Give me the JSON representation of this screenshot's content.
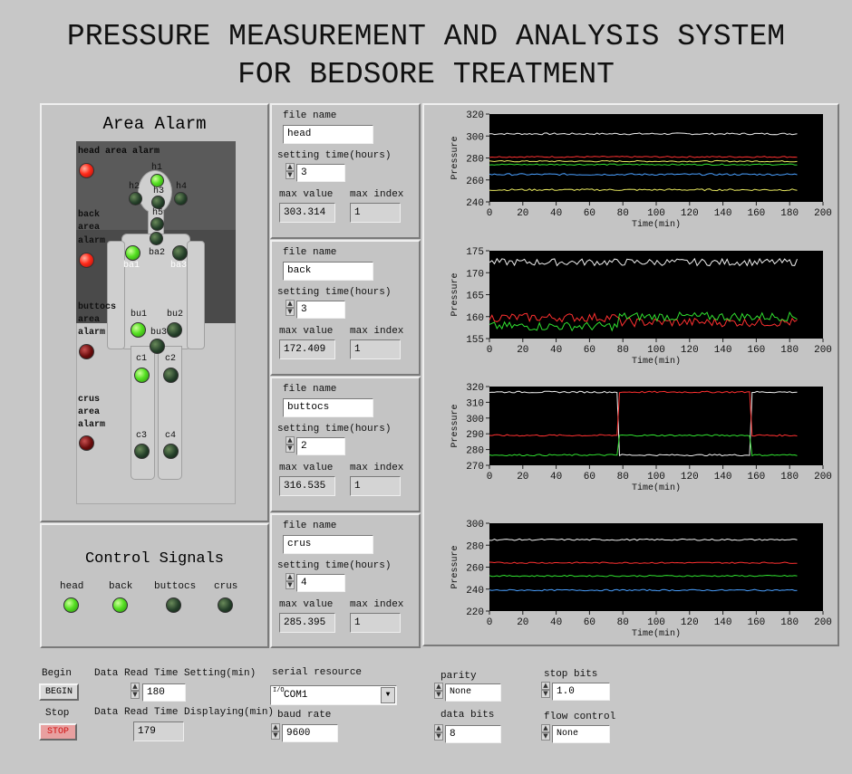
{
  "title_line1": "PRESSURE MEASUREMENT AND ANALYSIS SYSTEM",
  "title_line2": "FOR BEDSORE TREATMENT",
  "area_alarm": {
    "title": "Area Alarm",
    "alarm_labels": {
      "head": "head area alarm",
      "back1": "back",
      "back2": "area",
      "back3": "alarm",
      "buttocs1": "buttocs",
      "buttocs2": "area",
      "buttocs3": "alarm",
      "crus1": "crus",
      "crus2": "area",
      "crus3": "alarm"
    },
    "sensors": {
      "h1": "h1",
      "h2": "h2",
      "h3": "h3",
      "h4": "h4",
      "h5": "h5",
      "ba1": "ba1",
      "ba2": "ba2",
      "ba3": "ba3",
      "bu1": "bu1",
      "bu2": "bu2",
      "bu3": "bu3",
      "c1": "c1",
      "c2": "c2",
      "c3": "c3",
      "c4": "c4"
    }
  },
  "control_signals": {
    "title": "Control Signals",
    "labels": [
      "head",
      "back",
      "buttocs",
      "crus"
    ]
  },
  "areas": [
    {
      "file_name_label": "file name",
      "file_name": "head",
      "setting_label": "setting time(hours)",
      "setting_time": "3",
      "max_value_label": "max value",
      "max_value": "303.314",
      "max_index_label": "max index",
      "max_index": "1"
    },
    {
      "file_name_label": "file name",
      "file_name": "back",
      "setting_label": "setting time(hours)",
      "setting_time": "3",
      "max_value_label": "max value",
      "max_value": "172.409",
      "max_index_label": "max index",
      "max_index": "1"
    },
    {
      "file_name_label": "file name",
      "file_name": "buttocs",
      "setting_label": "setting time(hours)",
      "setting_time": "2",
      "max_value_label": "max value",
      "max_value": "316.535",
      "max_index_label": "max index",
      "max_index": "1"
    },
    {
      "file_name_label": "file name",
      "file_name": "crus",
      "setting_label": "setting time(hours)",
      "setting_time": "4",
      "max_value_label": "max value",
      "max_value": "285.395",
      "max_index_label": "max index",
      "max_index": "1"
    }
  ],
  "bottom": {
    "begin_label": "Begin",
    "begin_button": "BEGIN",
    "stop_label": "Stop",
    "stop_button": "STOP",
    "read_setting_label": "Data Read Time Setting(min)",
    "read_setting_value": "180",
    "read_display_label": "Data Read Time Displaying(min)",
    "read_display_value": "179",
    "serial_label": "serial resource",
    "serial_value": "COM1",
    "serial_prefix": "I/O",
    "baud_label": "baud rate",
    "baud_value": "9600",
    "parity_label": "parity",
    "parity_value": "None",
    "data_bits_label": "data bits",
    "data_bits_value": "8",
    "stop_bits_label": "stop bits",
    "stop_bits_value": "1.0",
    "flow_label": "flow control",
    "flow_value": "None"
  },
  "colors": {
    "panel": "#c4c4c4",
    "plot_bg": "#000000",
    "white": "#f0f0f0",
    "red": "#ff3030",
    "green": "#30e030",
    "blue": "#4aa0ff",
    "yellow": "#e8e860"
  },
  "chart_data": [
    {
      "type": "line",
      "ylabel": "Pressure",
      "xlabel": "Time(min)",
      "xlim": [
        0,
        200
      ],
      "ylim": [
        240,
        320
      ],
      "xticks": [
        0,
        20,
        40,
        60,
        80,
        100,
        120,
        140,
        160,
        180,
        200
      ],
      "yticks": [
        240,
        260,
        280,
        300,
        320
      ],
      "x_end": 185,
      "series": [
        {
          "color": "white",
          "mean": 302,
          "amp": 0.8
        },
        {
          "color": "red",
          "mean": 281,
          "amp": 0.6
        },
        {
          "color": "yellow",
          "mean": 277,
          "amp": 0.6
        },
        {
          "color": "green",
          "mean": 274,
          "amp": 0.6
        },
        {
          "color": "blue",
          "mean": 265,
          "amp": 0.8
        },
        {
          "color": "yellow",
          "mean": 251,
          "amp": 0.8
        }
      ]
    },
    {
      "type": "line",
      "ylabel": "Pressure",
      "xlabel": "Time(min)",
      "xlim": [
        0,
        200
      ],
      "ylim": [
        155,
        175
      ],
      "xticks": [
        0,
        20,
        40,
        60,
        80,
        100,
        120,
        140,
        160,
        180,
        200
      ],
      "yticks": [
        155,
        160,
        165,
        170,
        175
      ],
      "x_end": 185,
      "series": [
        {
          "color": "white",
          "mean": 172.4,
          "amp": 0.8
        },
        {
          "color": "red",
          "mean": 159.8,
          "amp": 1.0,
          "shift_at": 78,
          "shift_mean": 158.7
        },
        {
          "color": "green",
          "mean": 157.8,
          "amp": 1.0,
          "shift_at": 78,
          "shift_mean": 160.0
        }
      ]
    },
    {
      "type": "line",
      "ylabel": "Pressure",
      "xlabel": "Time(min)",
      "xlim": [
        0,
        200
      ],
      "ylim": [
        270,
        320
      ],
      "xticks": [
        0,
        20,
        40,
        60,
        80,
        100,
        120,
        140,
        160,
        180,
        200
      ],
      "yticks": [
        270,
        280,
        290,
        300,
        310,
        320
      ],
      "x_end": 185,
      "series": [
        {
          "color": "white",
          "mean": 316.5,
          "amp": 0.5,
          "steps": [
            [
              0,
              316.5
            ],
            [
              77,
              276.5
            ],
            [
              157,
              316.5
            ]
          ]
        },
        {
          "color": "red",
          "mean": 289,
          "amp": 0.5,
          "steps": [
            [
              0,
              289
            ],
            [
              77,
              316.5
            ],
            [
              157,
              289
            ]
          ]
        },
        {
          "color": "green",
          "mean": 276.5,
          "amp": 0.5,
          "steps": [
            [
              0,
              276.5
            ],
            [
              77,
              289
            ],
            [
              157,
              276.5
            ]
          ]
        }
      ]
    },
    {
      "type": "line",
      "ylabel": "Pressure",
      "xlabel": "Time(min)",
      "xlim": [
        0,
        200
      ],
      "ylim": [
        220,
        300
      ],
      "xticks": [
        0,
        20,
        40,
        60,
        80,
        100,
        120,
        140,
        160,
        180,
        200
      ],
      "yticks": [
        220,
        240,
        260,
        280,
        300
      ],
      "x_end": 185,
      "series": [
        {
          "color": "white",
          "mean": 285,
          "amp": 0.7
        },
        {
          "color": "red",
          "mean": 264,
          "amp": 0.6
        },
        {
          "color": "green",
          "mean": 252,
          "amp": 0.6
        },
        {
          "color": "blue",
          "mean": 239,
          "amp": 0.6
        }
      ]
    }
  ]
}
